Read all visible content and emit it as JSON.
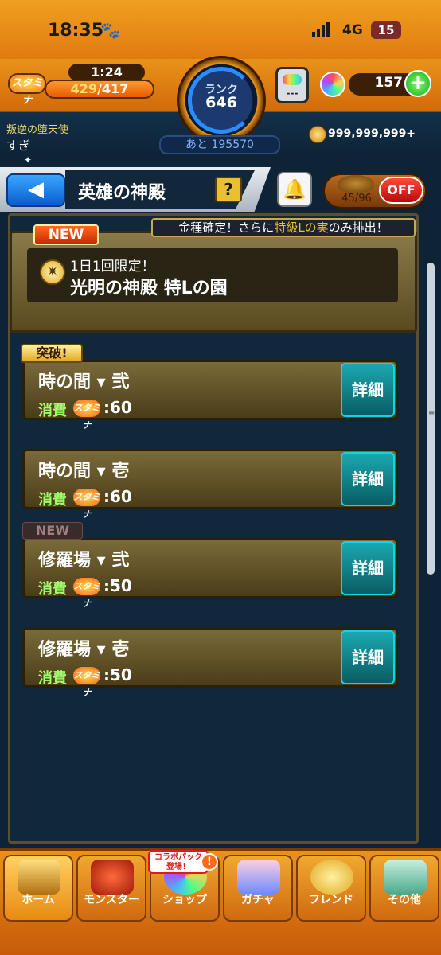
{
  "status_bar": {
    "time": "18:35",
    "network": "4G",
    "battery": "15"
  },
  "header": {
    "stamina_icon_label": "スタミナ",
    "stamina_timer": "1:24",
    "stamina_current": "429",
    "stamina_max": "/417",
    "rank_label": "ランク",
    "rank_value": "646",
    "rank_next": "あと 195570",
    "orb_count": "157",
    "coins": "999,999,999+",
    "player_title": "叛逆の堕天使",
    "player_name": "すぎ",
    "robot_dash": "---"
  },
  "nav": {
    "back_label": "◀",
    "page_title": "英雄の神殿",
    "help_label": "?",
    "toggle_count": "45/96",
    "toggle_state": "OFF"
  },
  "banner": {
    "text_before": "金種確定！さらに",
    "text_gold": "特級Lの実",
    "text_after": "のみ排出！"
  },
  "featured": {
    "badge": "NEW",
    "subtitle": "1日1回限定！",
    "title": "光明の神殿 特Lの園"
  },
  "quests": [
    {
      "name": "時の間 ▾ 弐",
      "cost_label": "消費",
      "stamina_icon": "スタミナ",
      "cost_value": ":60",
      "detail_label": "詳細",
      "badge": "突破!"
    },
    {
      "name": "時の間 ▾ 壱",
      "cost_label": "消費",
      "stamina_icon": "スタミナ",
      "cost_value": ":60",
      "detail_label": "詳細"
    },
    {
      "name": "修羅場 ▾ 弐",
      "cost_label": "消費",
      "stamina_icon": "スタミナ",
      "cost_value": ":50",
      "detail_label": "詳細",
      "badge": "NEW"
    },
    {
      "name": "修羅場 ▾ 壱",
      "cost_label": "消費",
      "stamina_icon": "スタミナ",
      "cost_value": ":50",
      "detail_label": "詳細"
    }
  ],
  "bottom_nav": {
    "items": [
      {
        "label": "ホーム",
        "icon": "home-gate-icon"
      },
      {
        "label": "モンスター",
        "icon": "monster-icon"
      },
      {
        "label": "ショップ",
        "icon": "orb-shop-icon"
      },
      {
        "label": "ガチャ",
        "icon": "gacha-characters-icon"
      },
      {
        "label": "フレンド",
        "icon": "friend-bells-icon"
      },
      {
        "label": "その他",
        "icon": "other-question-icon"
      }
    ],
    "collab_badge": "コラボパック 登場！",
    "alert": "!"
  },
  "colors": {
    "accent_orange": "#e8931a",
    "panel_bg": "#10283c",
    "detail_teal": "#1aa8b0",
    "cost_green": "#9fff6a"
  },
  "stamina_fill_fraction": 1.0
}
